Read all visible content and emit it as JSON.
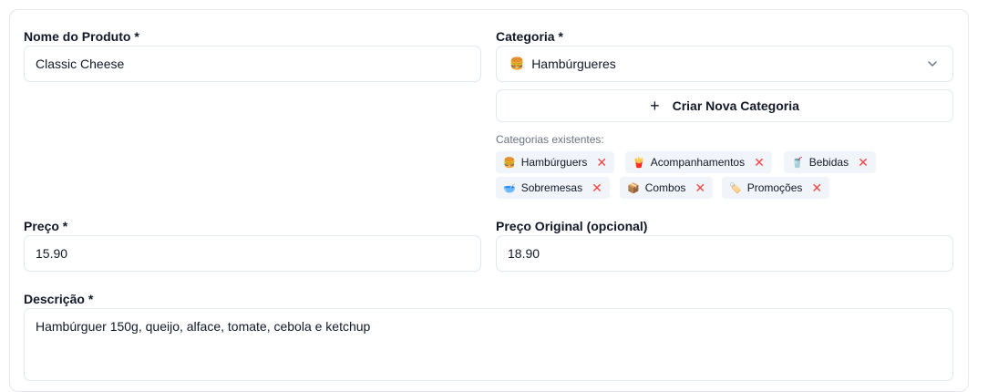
{
  "form": {
    "name": {
      "label": "Nome do Produto *",
      "value": "Classic Cheese"
    },
    "category": {
      "label": "Categoria *",
      "selected_emoji": "🍔",
      "selected": "Hambúrgueres",
      "create_button": "Criar Nova Categoria",
      "existing_label": "Categorias existentes:",
      "chips": [
        {
          "emoji": "🍔",
          "label": "Hambúrguers"
        },
        {
          "emoji": "🍟",
          "label": "Acompanhamentos"
        },
        {
          "emoji": "🥤",
          "label": "Bebidas"
        },
        {
          "emoji": "🥣",
          "label": "Sobremesas"
        },
        {
          "emoji": "📦",
          "label": "Combos"
        },
        {
          "emoji": "🏷️",
          "label": "Promoções"
        }
      ]
    },
    "price": {
      "label": "Preço *",
      "value": "15.90"
    },
    "original_price": {
      "label": "Preço Original (opcional)",
      "value": "18.90"
    },
    "description": {
      "label": "Descrição *",
      "value": "Hambúrguer 150g, queijo, alface, tomate, cebola e ketchup"
    }
  },
  "icons": {
    "remove": "close-icon",
    "dropdown": "chevron-down-icon",
    "add": "plus-icon"
  },
  "colors": {
    "remove_x": "#ef4444",
    "chip_bg": "#f1f5f9",
    "border": "#e2e8f0"
  }
}
